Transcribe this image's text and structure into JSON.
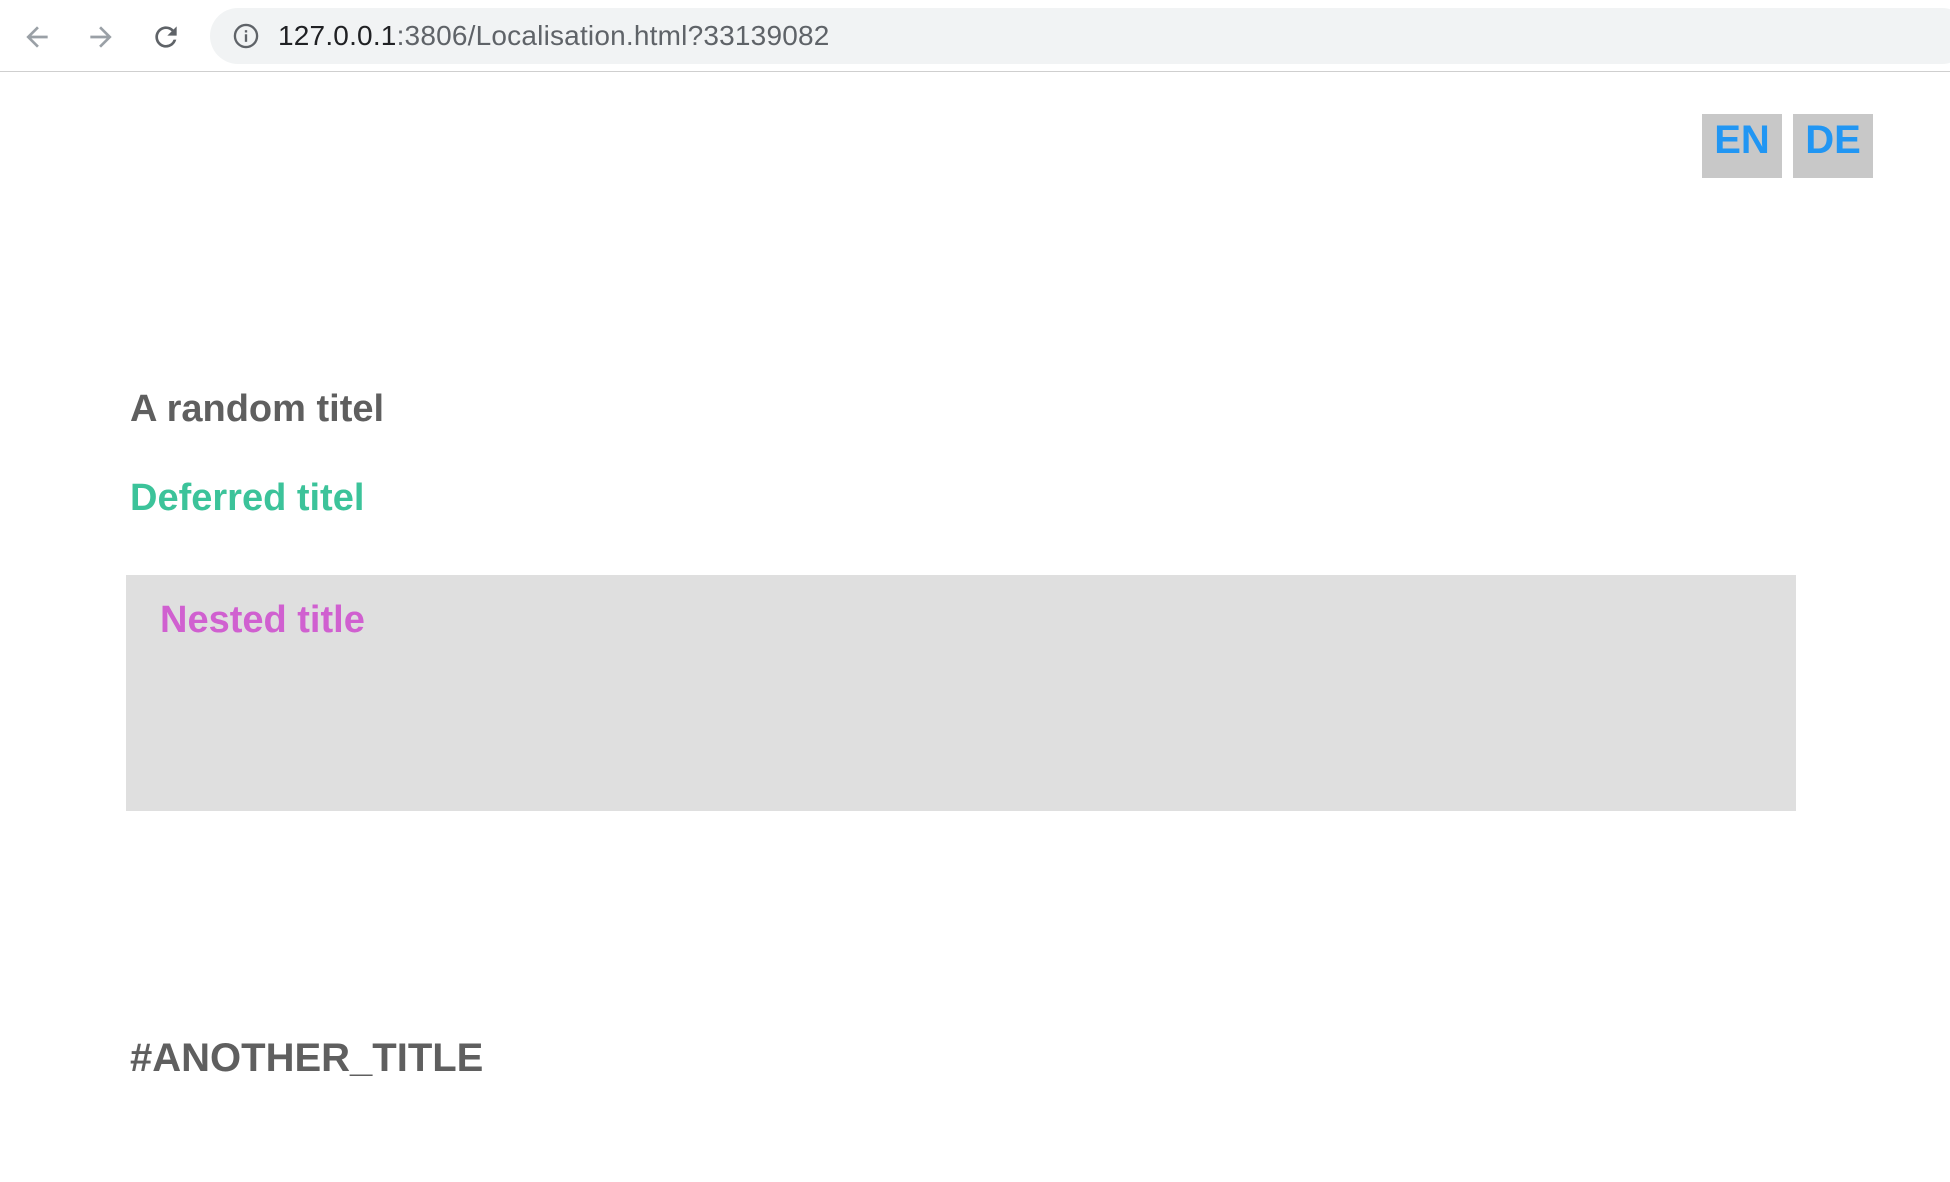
{
  "browser": {
    "url_host": "127.0.0.1",
    "url_rest": ":3806/Localisation.html?33139082",
    "icons": {
      "back": "arrow-left-icon",
      "forward": "arrow-right-icon",
      "reload": "reload-icon",
      "info": "info-icon"
    }
  },
  "language_switch": {
    "en_label": "EN",
    "de_label": "DE"
  },
  "content": {
    "random_title": "A random titel",
    "deferred_title": "Deferred titel",
    "nested_title": "Nested title",
    "another_title": "#ANOTHER_TITLE"
  },
  "colors": {
    "lang_button_bg": "#c8c8c8",
    "lang_button_text": "#2196f3",
    "title_gray": "#5f5f5f",
    "deferred_green": "#3cc39a",
    "nested_pink": "#d060d0",
    "nested_box_bg": "#dfdfdf"
  }
}
